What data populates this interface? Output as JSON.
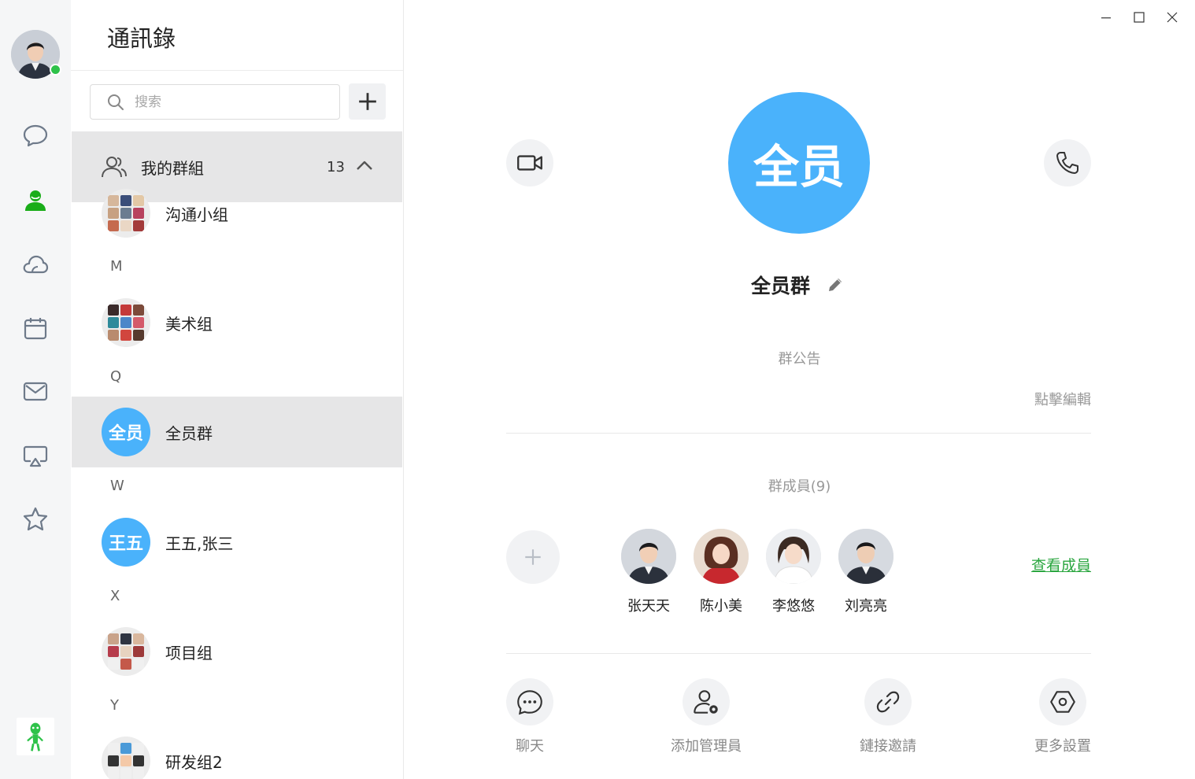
{
  "sidebar": {
    "nav": [
      {
        "name": "chat-bubble-icon"
      },
      {
        "name": "contacts-icon",
        "active": true
      },
      {
        "name": "cloud-icon"
      },
      {
        "name": "calendar-icon"
      },
      {
        "name": "mail-icon"
      },
      {
        "name": "screen-share-icon"
      },
      {
        "name": "star-icon"
      }
    ],
    "active_color": "#1aad19",
    "status_color": "#2ec24a"
  },
  "contacts": {
    "title": "通訊錄",
    "search": {
      "placeholder": "搜索",
      "value": ""
    },
    "group_header": {
      "label": "我的群組",
      "count": "13"
    },
    "items": [
      {
        "letter": "",
        "name": "沟通小组",
        "avatar_text": ""
      },
      {
        "letter": "M",
        "name": "美术组",
        "avatar_text": ""
      },
      {
        "letter": "Q",
        "name": "全员群",
        "avatar_text": "全员",
        "selected": true
      },
      {
        "letter": "W",
        "name": "王五,张三",
        "avatar_text": "王五"
      },
      {
        "letter": "X",
        "name": "项目组",
        "avatar_text": ""
      },
      {
        "letter": "Y",
        "name": "研发组2",
        "avatar_text": ""
      }
    ]
  },
  "detail": {
    "avatar_text": "全员",
    "group_name": "全员群",
    "announcement_label": "群公告",
    "click_edit": "點擊編輯",
    "members_label": "群成員(9)",
    "members": [
      {
        "name": "张天天"
      },
      {
        "name": "陈小美"
      },
      {
        "name": "李悠悠"
      },
      {
        "name": "刘亮亮"
      }
    ],
    "view_members": "查看成員",
    "actions": [
      {
        "label": "聊天",
        "icon": "chat-icon"
      },
      {
        "label": "添加管理員",
        "icon": "admin-settings-icon"
      },
      {
        "label": "鏈接邀請",
        "icon": "link-icon"
      },
      {
        "label": "更多設置",
        "icon": "settings-hexagon-icon"
      }
    ],
    "accent_color": "#4ab2fb",
    "link_color": "#2aa63f"
  }
}
